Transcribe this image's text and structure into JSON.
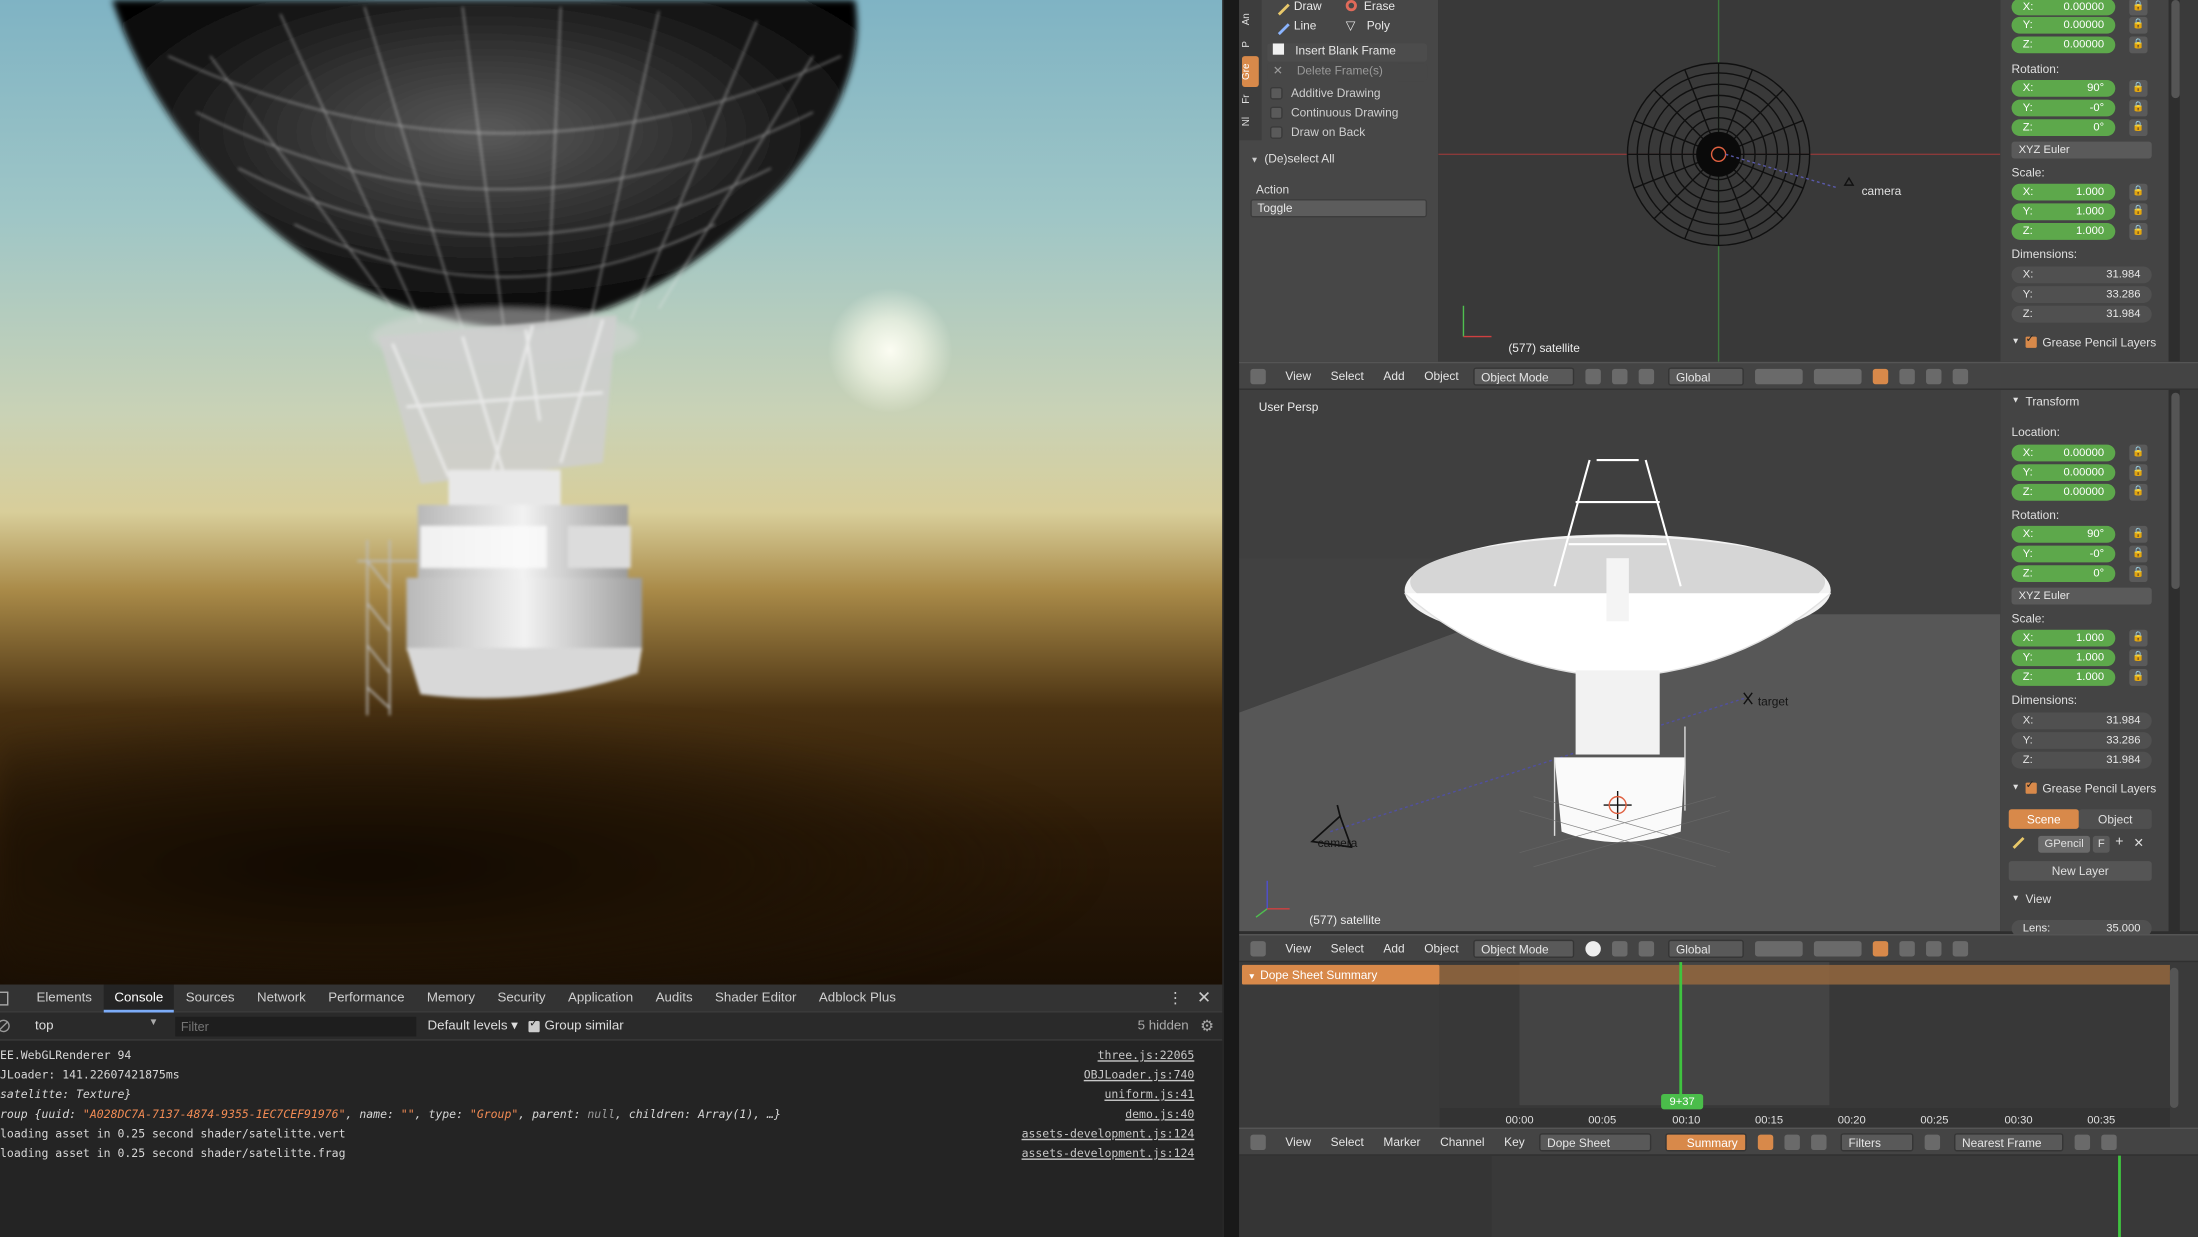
{
  "devtools": {
    "tabs": [
      "Elements",
      "Console",
      "Sources",
      "Network",
      "Performance",
      "Memory",
      "Security",
      "Application",
      "Audits",
      "Shader Editor",
      "Adblock Plus"
    ],
    "active_tab": "Console",
    "context": "top",
    "filter_placeholder": "Filter",
    "levels": "Default levels ▾",
    "group_similar": "Group similar",
    "hidden": "5 hidden",
    "logs": [
      {
        "msg": "EE.WebGLRenderer 94",
        "src": "three.js:22065"
      },
      {
        "msg": "JLoader: 141.22607421875ms",
        "src": "OBJLoader.js:740"
      },
      {
        "msg": "satelitte: Texture}",
        "src": "uniform.js:41"
      },
      {
        "msg_prefix": "roup {uuid: ",
        "uuid": "\"A028DC7A-7137-4874-9355-1EC7CEF91976\"",
        "mid": ", name: ",
        "name": "\"\"",
        "mid2": ", type: ",
        "type": "\"Group\"",
        "mid3": ", parent: ",
        "parent": "null",
        "tail": ", children: Array(1), …}",
        "src": "demo.js:40"
      },
      {
        "msg": "loading asset in 0.25 second shader/satelitte.vert",
        "src": "assets-development.js:124"
      },
      {
        "msg": "loading asset in 0.25 second shader/satelitte.frag",
        "src": "assets-development.js:124"
      }
    ]
  },
  "blender": {
    "toolshelf": {
      "tabs": [
        "An",
        "P",
        "Gre",
        "Fr",
        "Nl"
      ],
      "draw": "Draw",
      "erase": "Erase",
      "line": "Line",
      "poly": "Poly",
      "insert_blank": "Insert Blank Frame",
      "delete_frames": "Delete Frame(s)",
      "additive": "Additive Drawing",
      "continuous": "Continuous Drawing",
      "draw_on_back": "Draw on Back",
      "deselect_all": "(De)select All",
      "action_label": "Action",
      "action_value": "Toggle"
    },
    "top_view": {
      "camera_label": "camera",
      "object_label": "(577) satellite"
    },
    "persp_view": {
      "title": "User Persp",
      "target_label": "target",
      "camera_label": "camera",
      "object_label": "(577) satellite"
    },
    "header": {
      "view": "View",
      "select": "Select",
      "add": "Add",
      "object": "Object",
      "mode": "Object Mode",
      "orientation": "Global"
    },
    "props_top": {
      "loc": [
        {
          "axis": "X:",
          "val": "0.00000"
        },
        {
          "axis": "Y:",
          "val": "0.00000"
        },
        {
          "axis": "Z:",
          "val": "0.00000"
        }
      ],
      "rotation_label": "Rotation:",
      "rot": [
        {
          "axis": "X:",
          "val": "90°"
        },
        {
          "axis": "Y:",
          "val": "-0°"
        },
        {
          "axis": "Z:",
          "val": "0°"
        }
      ],
      "euler": "XYZ Euler",
      "scale_label": "Scale:",
      "scale": [
        {
          "axis": "X:",
          "val": "1.000"
        },
        {
          "axis": "Y:",
          "val": "1.000"
        },
        {
          "axis": "Z:",
          "val": "1.000"
        }
      ],
      "dimensions_label": "Dimensions:",
      "dims": [
        {
          "axis": "X:",
          "val": "31.984"
        },
        {
          "axis": "Y:",
          "val": "33.286"
        },
        {
          "axis": "Z:",
          "val": "31.984"
        }
      ],
      "gp_layers": "Grease Pencil Layers"
    },
    "props_bottom": {
      "transform": "Transform",
      "location_label": "Location:",
      "loc": [
        {
          "axis": "X:",
          "val": "0.00000"
        },
        {
          "axis": "Y:",
          "val": "0.00000"
        },
        {
          "axis": "Z:",
          "val": "0.00000"
        }
      ],
      "rotation_label": "Rotation:",
      "rot": [
        {
          "axis": "X:",
          "val": "90°"
        },
        {
          "axis": "Y:",
          "val": "-0°"
        },
        {
          "axis": "Z:",
          "val": "0°"
        }
      ],
      "euler": "XYZ Euler",
      "scale_label": "Scale:",
      "scale": [
        {
          "axis": "X:",
          "val": "1.000"
        },
        {
          "axis": "Y:",
          "val": "1.000"
        },
        {
          "axis": "Z:",
          "val": "1.000"
        }
      ],
      "dimensions_label": "Dimensions:",
      "dims": [
        {
          "axis": "X:",
          "val": "31.984"
        },
        {
          "axis": "Y:",
          "val": "33.286"
        },
        {
          "axis": "Z:",
          "val": "31.984"
        }
      ],
      "gp_layers": "Grease Pencil Layers",
      "scene": "Scene",
      "object": "Object",
      "gpencil": "GPencil",
      "f": "F",
      "new_layer": "New Layer",
      "view": "View",
      "lens_label": "Lens:",
      "lens_val": "35.000"
    },
    "dopesheet": {
      "summary": "Dope Sheet Summary",
      "current_frame": "9+37",
      "ticks": [
        "00:00",
        "00:05",
        "00:10",
        "00:15",
        "00:20",
        "00:25",
        "00:30",
        "00:35"
      ],
      "header": {
        "view": "View",
        "select": "Select",
        "marker": "Marker",
        "channel": "Channel",
        "key": "Key",
        "mode": "Dope Sheet",
        "summary": "Summary",
        "filters": "Filters",
        "interp": "Nearest Frame"
      }
    },
    "accent": "#d8894a",
    "green": "#5da84b"
  }
}
